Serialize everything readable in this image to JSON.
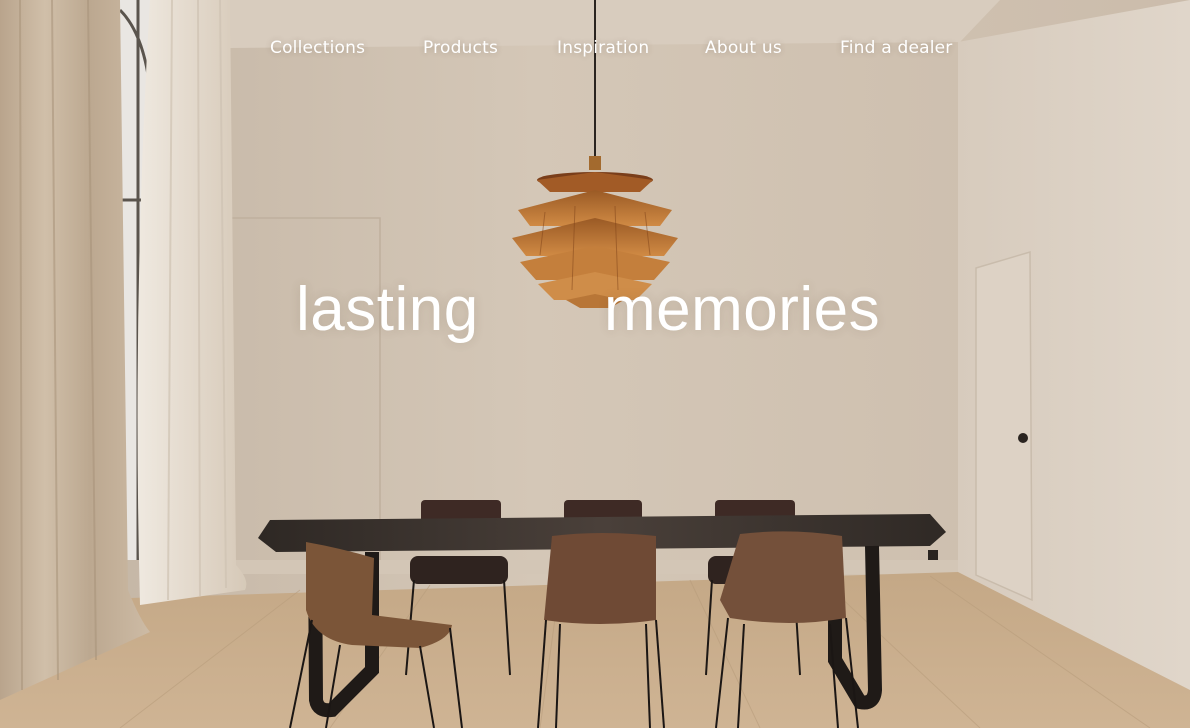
{
  "nav": {
    "items": [
      {
        "label": "Collections"
      },
      {
        "label": "Products"
      },
      {
        "label": "Inspiration"
      },
      {
        "label": "About us"
      },
      {
        "label": "Find a dealer"
      }
    ]
  },
  "hero": {
    "headline_left": "lasting",
    "headline_right": "memories"
  },
  "colors": {
    "nav_text": "#ffffff",
    "headline_text": "#ffffff",
    "wall": "#cfc2b2",
    "floor": "#c8ad8c",
    "lamp": "#b8702f",
    "chair": "#7a5236"
  }
}
